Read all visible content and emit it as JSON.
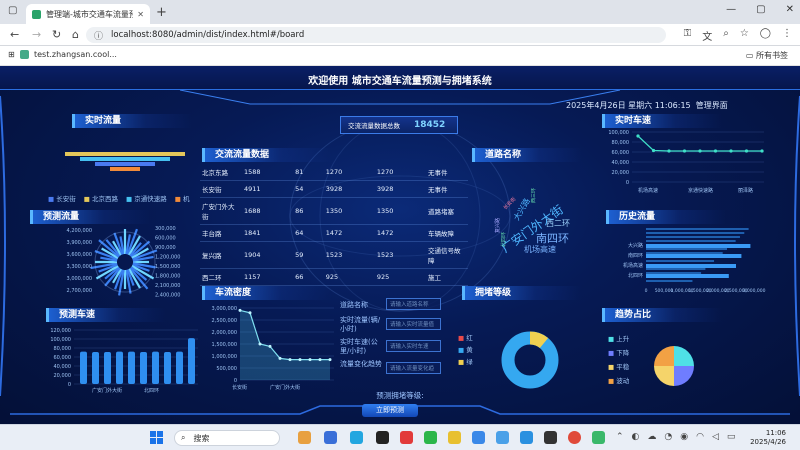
{
  "browser": {
    "tab_title": "管理端-城市交通车流量预测与",
    "new_tab": "+",
    "url": "localhost:8080/admin/dist/index.html#/board",
    "bookmark": "test.zhangsan.cool...",
    "bookmarks_all": "所有书签"
  },
  "header": {
    "title": "欢迎使用 城市交通车流量预测与拥堵系统",
    "datetime": "2025年4月26日 星期六 11:06:15",
    "admin_link": "管理界面"
  },
  "realtime_flow": {
    "title": "实时流量",
    "legend": [
      "长安街",
      "北京西路",
      "京通快速路",
      "机"
    ]
  },
  "predict_flow": {
    "title": "预测流量",
    "labels": [
      "4,200,000",
      "3,900,000",
      "3,600,000",
      "3,300,000",
      "3,000,000",
      "2,700,000",
      "300,000",
      "600,000",
      "900,000",
      "1,200,000",
      "1,500,000",
      "1,800,000",
      "2,100,000",
      "2,400,000"
    ]
  },
  "predict_speed": {
    "title": "预测车速",
    "yticks": [
      "120,000",
      "100,000",
      "80,000",
      "60,000",
      "40,000",
      "20,000",
      "0"
    ],
    "xticks": [
      "广安门外大街",
      "北四环"
    ],
    "values": [
      72000,
      71000,
      71000,
      72000,
      72000,
      71000,
      72000,
      71000,
      72000,
      102000
    ]
  },
  "traffic_data": {
    "title": "交流流量数据",
    "total_label": "交流流量数据总数",
    "total_value": "18452",
    "rows": [
      [
        "北京东路",
        "1588",
        "81",
        "1270",
        "1270",
        "无事件"
      ],
      [
        "长安街",
        "4911",
        "54",
        "3928",
        "3928",
        "无事件"
      ],
      [
        "广安门外大街",
        "1688",
        "86",
        "1350",
        "1350",
        "道路堵塞"
      ],
      [
        "丰台路",
        "1841",
        "64",
        "1472",
        "1472",
        "车辆故障"
      ],
      [
        "复兴路",
        "1904",
        "59",
        "1523",
        "1523",
        "交通信号故障"
      ],
      [
        "西二环",
        "1157",
        "66",
        "925",
        "925",
        "施工"
      ]
    ]
  },
  "road_name_cloud": {
    "title": "道路名称",
    "words": [
      "广安门外大街",
      "南四环",
      "西二环",
      "机场高速",
      "大兴路",
      "北四环",
      "复兴路",
      "长安街",
      "西三环"
    ]
  },
  "density": {
    "title": "车流密度",
    "yticks": [
      "3,000,000",
      "2,500,000",
      "2,000,000",
      "1,500,000",
      "1,000,000",
      "500,000",
      "0"
    ],
    "xticks": [
      "长安街",
      "广安门外大街"
    ],
    "values": [
      2900000,
      2800000,
      1500000,
      1400000,
      900000,
      850000,
      850000,
      850000,
      850000,
      850000
    ]
  },
  "predict_form": {
    "road_label": "道路名称",
    "road_placeholder": "请输入道路名称",
    "flow_label": "实时流量(辆/小时)",
    "flow_placeholder": "请输入实时流量值",
    "speed_label": "实时车速(公里/小时)",
    "speed_placeholder": "请输入实时车速",
    "trend_label": "流量变化趋势",
    "trend_placeholder": "请输入流量变化趋",
    "result_label": "预测拥堵等级:",
    "button": "立即预测"
  },
  "congestion": {
    "title": "拥堵等级",
    "legend": [
      "红",
      "黄",
      "绿"
    ],
    "colors": [
      "#35a8f0",
      "#f0d050",
      "#e84a4a"
    ]
  },
  "realtime_speed": {
    "title": "实时车速",
    "yticks": [
      "100,000",
      "80,000",
      "60,000",
      "40,000",
      "20,000",
      "0"
    ],
    "xticks": [
      "机场高速",
      "京通快速路",
      "丽泽路"
    ],
    "values": [
      92000,
      63000,
      62000,
      62000,
      62000,
      62000,
      62000,
      62000,
      62000
    ]
  },
  "history_flow": {
    "title": "历史流量",
    "categories": [
      "大兴路",
      "南四环",
      "机场高速",
      "北四环"
    ],
    "xticks": [
      "0",
      "500,000",
      "1,000,000",
      "1,500,000",
      "2,000,000",
      "2,500,000",
      "3,000,000"
    ],
    "values": [
      2900000,
      2650000,
      2500000,
      2300000
    ]
  },
  "trend": {
    "title": "趋势占比",
    "legend": [
      "上升",
      "下降",
      "平稳",
      "波动"
    ],
    "colors": [
      "#4fe0e6",
      "#6f7dff",
      "#f5d46a",
      "#f2a144"
    ]
  },
  "taskbar": {
    "search": "搜索",
    "time": "11:06",
    "date": "2025/4/26"
  }
}
